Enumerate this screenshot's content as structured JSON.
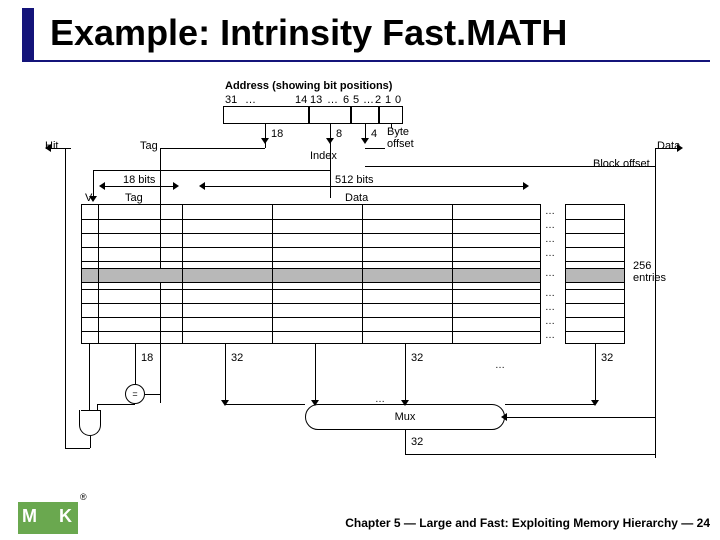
{
  "title": "Example: Intrinsity Fast.MATH",
  "address_label": "Address (showing bit positions)",
  "bit_positions": [
    "31",
    "…",
    "14",
    "13",
    "…",
    "6",
    "5",
    "…",
    "2",
    "1",
    "0"
  ],
  "field_widths": {
    "tag": "18",
    "index": "8",
    "byte_offset": "4"
  },
  "signals": {
    "hit": "Hit",
    "tag": "Tag",
    "index": "Index",
    "byte_offset": "Byte\noffset",
    "block_offset": "Block offset",
    "data": "Data"
  },
  "column_bits": {
    "tag_col": "18 bits",
    "data_col": "512 bits"
  },
  "columns": {
    "v": "V",
    "tag": "Tag",
    "data": "Data"
  },
  "entries_label": "256\nentries",
  "bottom_widths": [
    "18",
    "32",
    "32",
    "32"
  ],
  "mux_label": "Mux",
  "mux_out": "32",
  "footer": "Chapter 5 — Large and Fast: Exploiting Memory Hierarchy — 24",
  "logo": {
    "m": "M",
    "k": "K",
    "reg": "®"
  },
  "ellipsis": "…"
}
